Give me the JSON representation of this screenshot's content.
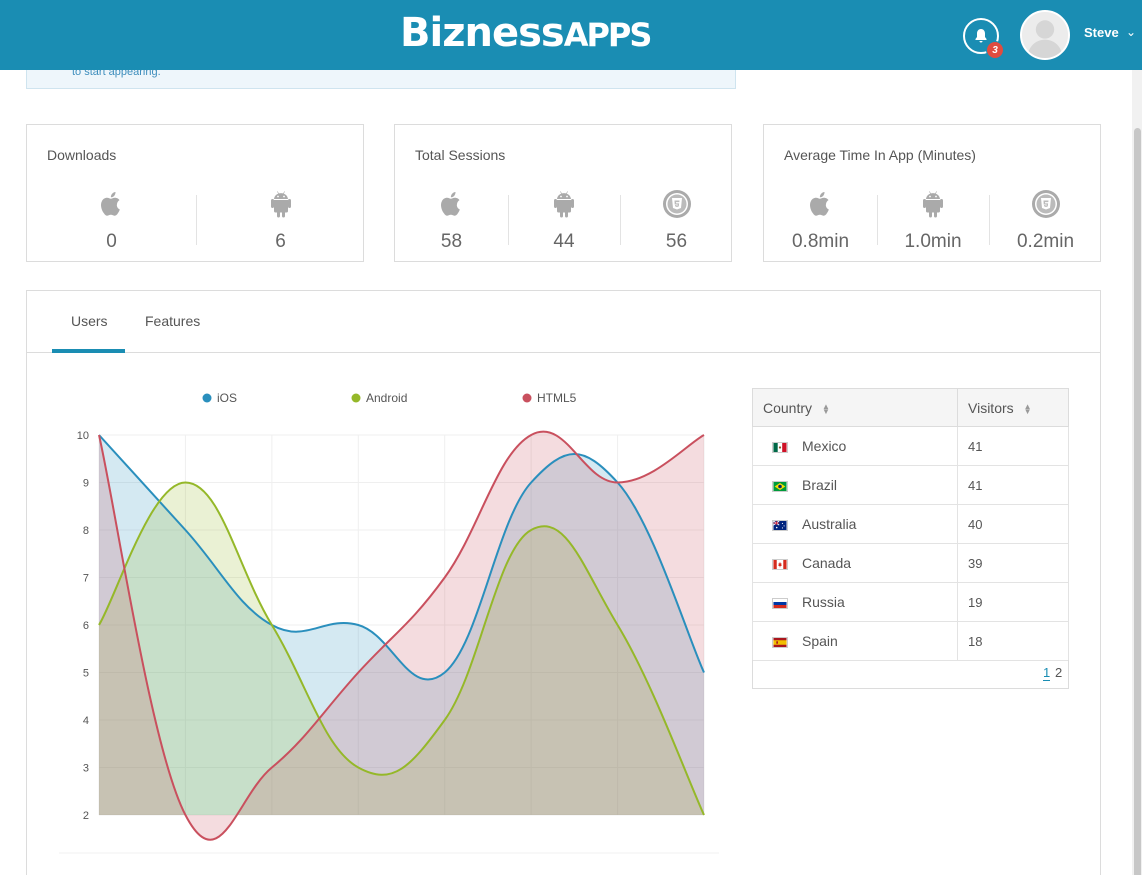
{
  "header": {
    "logo_part1": "Bizness",
    "logo_part2": "APPS",
    "notification_count": "3",
    "username": "Steve"
  },
  "alert": {
    "text": "to start appearing."
  },
  "stats": [
    {
      "title": "Downloads",
      "values": [
        "0",
        "6"
      ],
      "icons": [
        "apple-icon",
        "android-icon"
      ]
    },
    {
      "title": "Total Sessions",
      "values": [
        "58",
        "44",
        "56"
      ],
      "icons": [
        "apple-icon",
        "android-icon",
        "html5-icon"
      ]
    },
    {
      "title": "Average Time In App (Minutes)",
      "values": [
        "0.8min",
        "1.0min",
        "0.2min"
      ],
      "icons": [
        "apple-icon",
        "android-icon",
        "html5-icon"
      ]
    }
  ],
  "tabs": [
    "Users",
    "Features"
  ],
  "table": {
    "headers": [
      "Country",
      "Visitors"
    ],
    "rows": [
      {
        "country": "Mexico",
        "visitors": "41"
      },
      {
        "country": "Brazil",
        "visitors": "41"
      },
      {
        "country": "Australia",
        "visitors": "40"
      },
      {
        "country": "Canada",
        "visitors": "39"
      },
      {
        "country": "Russia",
        "visitors": "19"
      },
      {
        "country": "Spain",
        "visitors": "18"
      }
    ],
    "pages": [
      "1",
      "2"
    ]
  },
  "chart_data": {
    "type": "area",
    "x": [
      1,
      2,
      3,
      4,
      5,
      6,
      7,
      8
    ],
    "ylim": [
      2,
      10
    ],
    "yticks": [
      2,
      3,
      4,
      5,
      6,
      7,
      8,
      9,
      10
    ],
    "grid": true,
    "legend": "top",
    "series": [
      {
        "name": "iOS",
        "color": "#2a8fbd",
        "values": [
          10,
          8,
          6,
          6,
          5,
          9,
          9,
          5
        ]
      },
      {
        "name": "Android",
        "color": "#95b829",
        "values": [
          6,
          9,
          6,
          3,
          4,
          8,
          6,
          2
        ]
      },
      {
        "name": "HTML5",
        "color": "#c9505e",
        "values": [
          10,
          2,
          3,
          5,
          7,
          10,
          9,
          10
        ]
      }
    ]
  }
}
